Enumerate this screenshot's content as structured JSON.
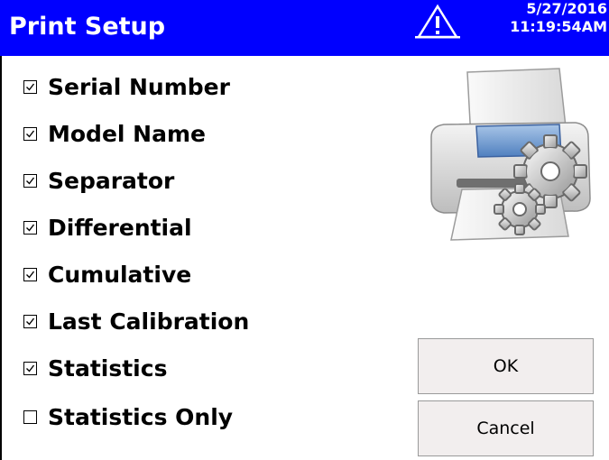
{
  "header": {
    "title": "Print Setup",
    "date": "5/27/2016",
    "time": "11:19:54AM",
    "warning_icon": "warning-triangle-icon",
    "background": "#0000ff"
  },
  "options": [
    {
      "label": "Serial Number",
      "checked": true
    },
    {
      "label": "Model Name",
      "checked": true
    },
    {
      "label": "Separator",
      "checked": true
    },
    {
      "label": "Differential",
      "checked": true
    },
    {
      "label": "Cumulative",
      "checked": true
    },
    {
      "label": "Last Calibration",
      "checked": true
    },
    {
      "label": "Statistics",
      "checked": true
    },
    {
      "label": "Statistics Only",
      "checked": false
    }
  ],
  "illustration": "printer-settings-icon",
  "buttons": {
    "ok": "OK",
    "cancel": "Cancel"
  }
}
